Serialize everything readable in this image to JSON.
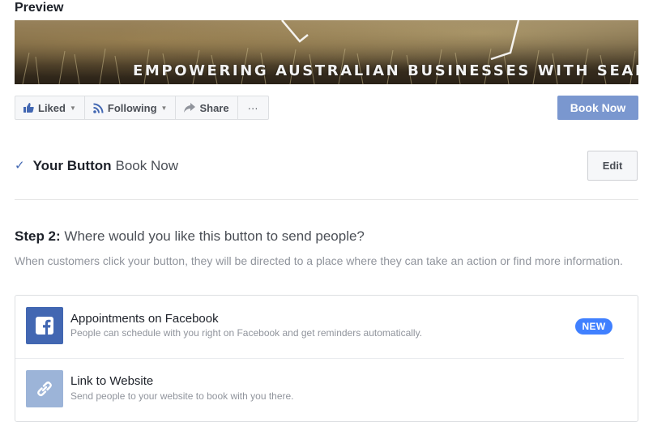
{
  "preview": {
    "title": "Preview"
  },
  "cover": {
    "text": "EMPOWERING AUSTRALIAN BUSINESSES WITH SEARCH MARKET"
  },
  "actionbar": {
    "liked": "Liked",
    "following": "Following",
    "share": "Share",
    "more": "···"
  },
  "cta": {
    "label": "Book Now",
    "color": "#7a97cf"
  },
  "your_button": {
    "label": "Your Button",
    "value": "Book Now",
    "edit": "Edit"
  },
  "step2": {
    "number": "Step 2:",
    "question": "Where would you like this button to send people?",
    "description": "When customers click your button, they will be directed to a place where they can take an action or find more information."
  },
  "options": [
    {
      "title": "Appointments on Facebook",
      "subtitle": "People can schedule with you right on Facebook and get reminders automatically.",
      "badge": "NEW",
      "icon": "facebook-icon",
      "icon_color": "#4267b2"
    },
    {
      "title": "Link to Website",
      "subtitle": "Send people to your website to book with you there.",
      "icon": "link-icon",
      "icon_color": "#9cb4d8"
    }
  ]
}
